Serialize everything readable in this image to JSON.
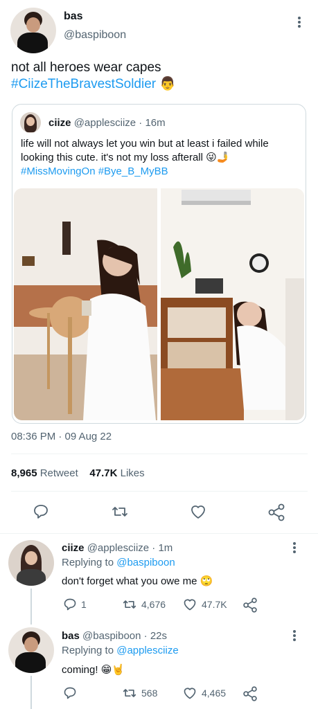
{
  "tweet": {
    "name": "bas",
    "handle": "@baspiboon",
    "text_line1": "not all heroes wear capes",
    "hashtag": "#CiizeTheBravestSoldier",
    "emoji": "👨",
    "timestamp": "08:36 PM · 09 Aug 22",
    "retweets_count": "8,965",
    "retweets_label": "Retweet",
    "likes_count": "47.7K",
    "likes_label": "Likes"
  },
  "quote": {
    "name": "ciize",
    "handle_time": "@applesciize · 16m",
    "text": "life will not always let you win but at least i failed while looking this cute. it's not my loss afterall 😜🤳",
    "hashtags": "#MissMovingOn #Bye_B_MyBB"
  },
  "actions": {
    "reply_icon": "reply-icon",
    "retweet_icon": "retweet-icon",
    "like_icon": "heart-icon",
    "share_icon": "share-icon"
  },
  "replies": [
    {
      "name": "ciize",
      "handle_time": "@applesciize · 1m",
      "replying_prefix": "Replying to",
      "replying_to": "@baspiboon",
      "text": "don't forget what you owe me 🙄",
      "reply_count": "1",
      "retweet_count": "4,676",
      "like_count": "47.7K"
    },
    {
      "name": "bas",
      "handle_time": "@baspiboon · 22s",
      "replying_prefix": "Replying to",
      "replying_to": "@applesciize",
      "text": "coming! 😁🤘",
      "reply_count": "",
      "retweet_count": "568",
      "like_count": "4,465"
    }
  ],
  "colors": {
    "accent": "#1d9bf0",
    "text": "#0f1419",
    "secondary": "#536471",
    "border": "#cfd9de"
  }
}
